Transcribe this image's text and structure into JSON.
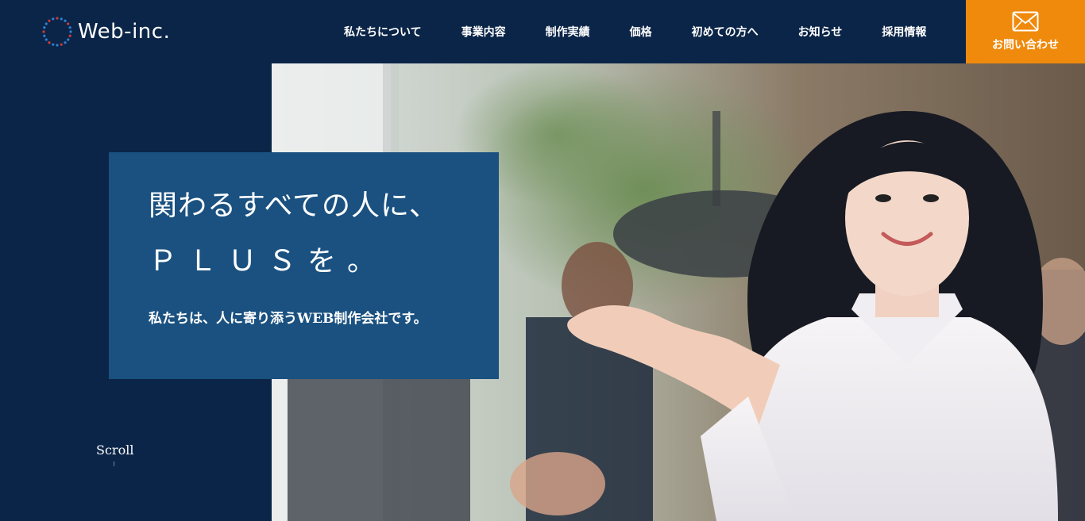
{
  "header": {
    "logo_text": "Web-inc.",
    "nav": [
      {
        "label": "私たちについて"
      },
      {
        "label": "事業内容"
      },
      {
        "label": "制作実績"
      },
      {
        "label": "価格"
      },
      {
        "label": "初めての方へ"
      },
      {
        "label": "お知らせ"
      },
      {
        "label": "採用情報"
      }
    ],
    "contact_label": "お問い合わせ"
  },
  "hero": {
    "headline_1": "関わるすべての人に、",
    "headline_2": "ＰＬＵＳを。",
    "subtext": "私たちは、人に寄り添うWEB制作会社です。",
    "scroll_label": "Scroll"
  },
  "colors": {
    "navy": "#0b2548",
    "card_blue": "#1a5180",
    "accent_orange": "#f08a0c",
    "logo_dot_blue": "#2f7fd0",
    "logo_dot_red": "#d03a3a"
  },
  "icons": {
    "logo": "dotted-circle-logo-icon",
    "contact": "envelope-icon"
  }
}
